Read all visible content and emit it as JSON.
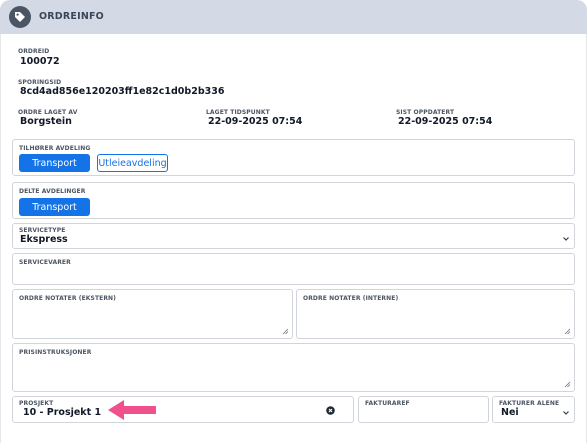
{
  "header": {
    "title": "ORDREINFO",
    "icon": "tag-icon"
  },
  "order": {
    "id_label": "ORDREID",
    "id_value": "100072",
    "tracking_label": "SPORINGSID",
    "tracking_value": "8cd4ad856e120203ff1e82c1d0b2b336",
    "created_by_label": "ORDRE LAGET AV",
    "created_by_value": "Borgstein",
    "created_at_label": "LAGET TIDSPUNKT",
    "created_at_value": "22-09-2025 07:54",
    "updated_label": "SIST OPPDATERT",
    "updated_value": "22-09-2025 07:54"
  },
  "department": {
    "label": "TILHØRER AVDELING",
    "options": [
      "Transport",
      "Utleieavdeling"
    ],
    "selected": "Transport"
  },
  "shared": {
    "label": "DELTE AVDELINGER",
    "options": [
      "Transport"
    ]
  },
  "service_type": {
    "label": "SERVICETYPE",
    "value": "Ekspress"
  },
  "service_goods": {
    "label": "SERVICEVARER",
    "value": ""
  },
  "notes_external": {
    "label": "ORDRE NOTATER (EKSTERN)",
    "value": ""
  },
  "notes_internal": {
    "label": "ORDRE NOTATER (INTERNE)",
    "value": ""
  },
  "price_instructions": {
    "label": "PRISINSTRUKSJONER",
    "value": ""
  },
  "project": {
    "label": "PROSJEKT",
    "value": "10 - Prosjekt 1"
  },
  "invoice_ref": {
    "label": "FAKTURAREF",
    "value": ""
  },
  "invoice_alone": {
    "label": "FAKTURER ALENE",
    "value": "Nei"
  },
  "colors": {
    "accent": "#1473e6",
    "header_bg": "#d3dae6",
    "annotation_arrow": "#f0508c"
  }
}
